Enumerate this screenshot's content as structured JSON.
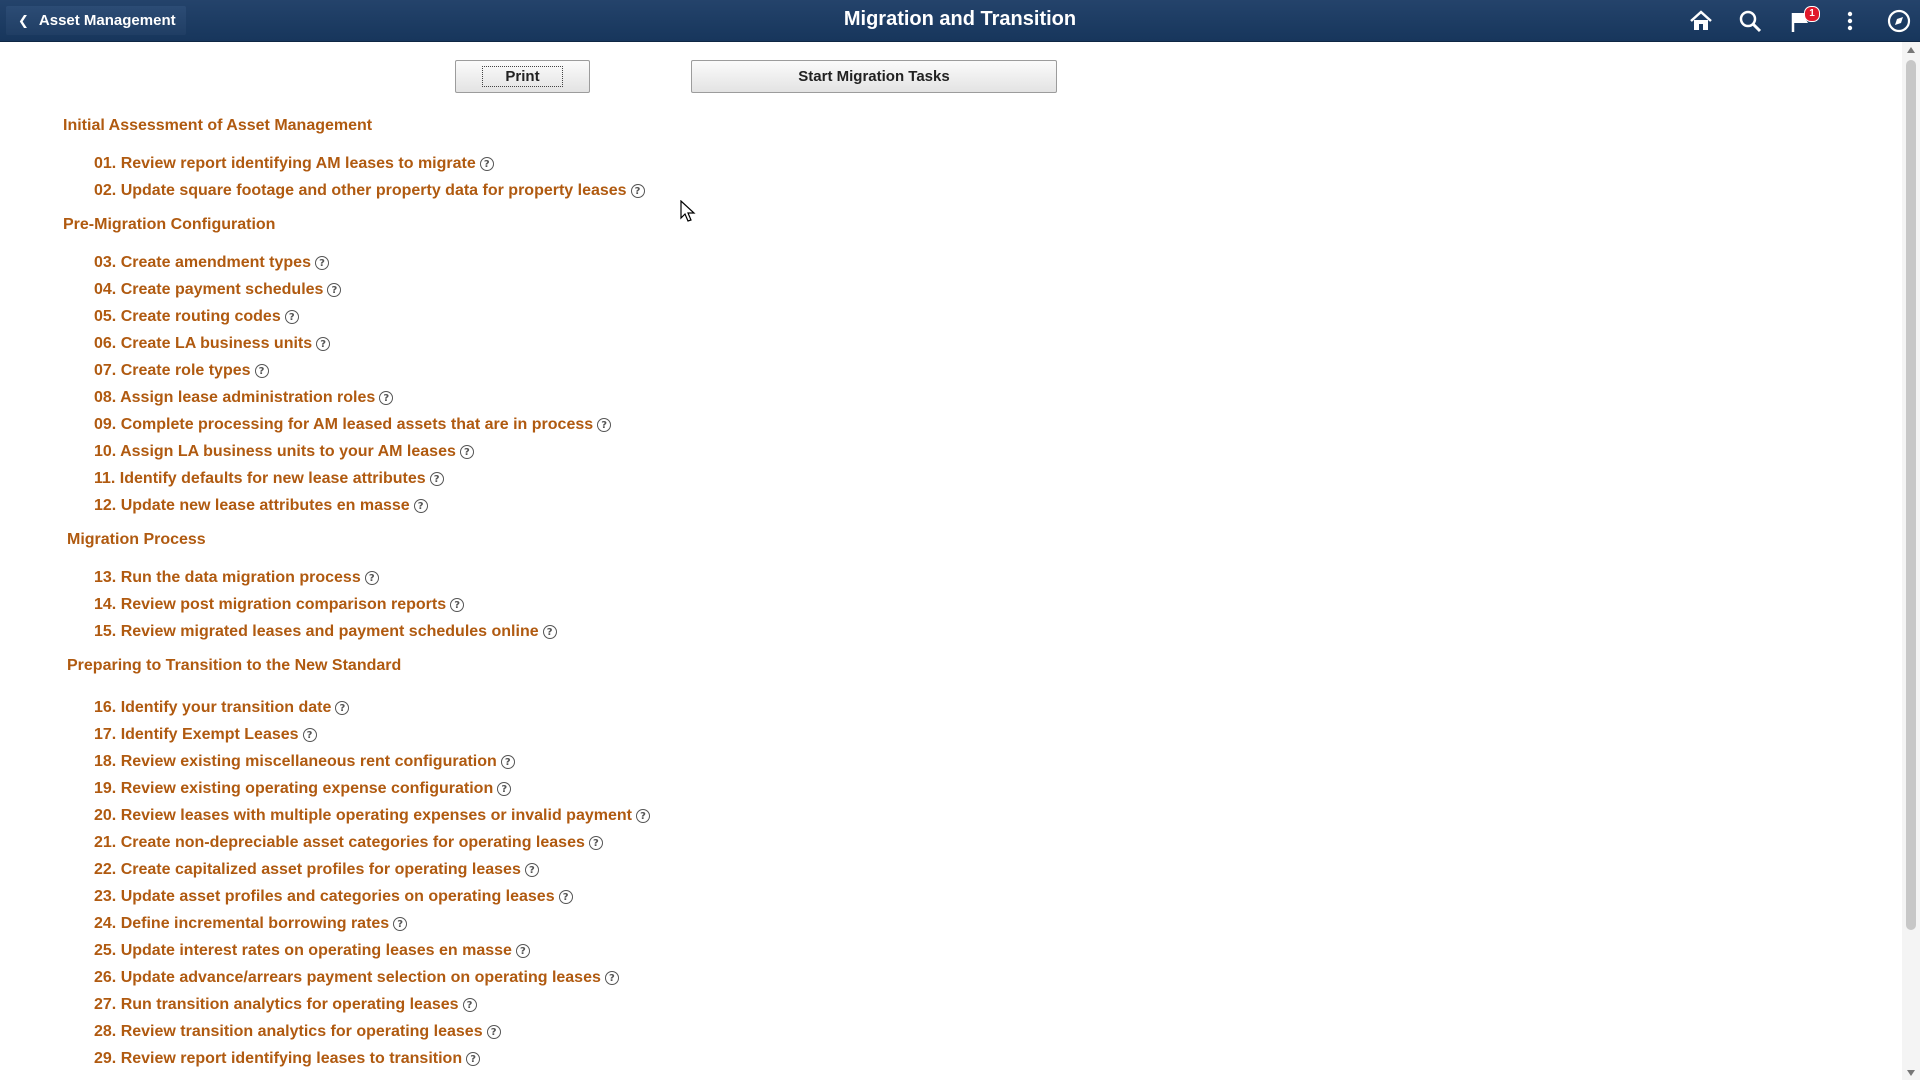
{
  "header": {
    "back_label": "Asset Management",
    "title": "Migration and Transition",
    "notification_count": "1",
    "icons": [
      "home-icon",
      "search-icon",
      "notification-flag-icon",
      "actions-menu-icon",
      "navbar-icon"
    ]
  },
  "buttons": {
    "print": "Print",
    "start": "Start Migration Tasks"
  },
  "sections": [
    {
      "title": "Initial Assessment of Asset Management",
      "tasks": [
        "01. Review report identifying AM leases to migrate",
        "02. Update square footage and other property data for property leases"
      ]
    },
    {
      "title": "Pre-Migration Configuration",
      "tasks": [
        "03. Create amendment types",
        "04. Create payment schedules",
        "05. Create routing codes",
        "06. Create LA business units",
        "07. Create role types",
        "08. Assign lease administration roles",
        "09. Complete processing for AM leased assets that are in process",
        "10. Assign LA business units to your AM leases",
        "11. Identify defaults for new lease attributes",
        "12. Update new lease attributes en masse"
      ]
    },
    {
      "title": "Migration Process",
      "tasks": [
        "13. Run the data migration process",
        "14. Review post migration comparison reports",
        "15. Review migrated leases and payment schedules online"
      ]
    },
    {
      "title": "Preparing to Transition to the New Standard",
      "tasks": [
        "16. Identify your transition date",
        "17. Identify Exempt Leases",
        "18. Review existing miscellaneous rent configuration",
        "19. Review existing operating expense configuration",
        "20. Review leases with multiple operating expenses or invalid payment",
        "21. Create non-depreciable asset categories for operating leases",
        "22. Create capitalized asset profiles for operating leases",
        "23. Update asset profiles and categories on operating leases",
        "24. Define incremental borrowing rates",
        "25. Update interest rates on operating leases en masse",
        "26. Update advance/arrears payment selection on operating leases",
        "27. Run transition analytics for operating leases",
        "28. Review transition analytics for operating leases",
        "29. Review report identifying leases to transition"
      ]
    }
  ],
  "help_glyph": "?",
  "colors": {
    "header_bg": "#1d3d63",
    "link": "#b05a10",
    "badge": "#e0192b"
  }
}
